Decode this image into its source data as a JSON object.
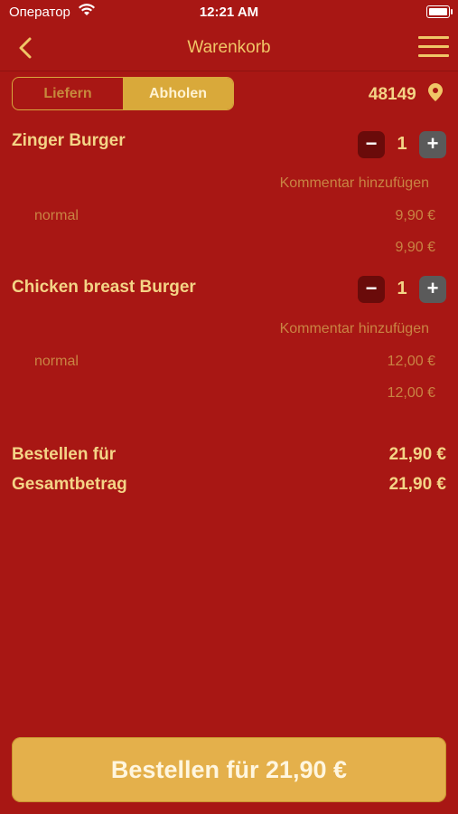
{
  "status_bar": {
    "carrier": "Оператор",
    "time": "12:21 AM"
  },
  "header": {
    "title": "Warenkorb"
  },
  "mode": {
    "options": [
      "Liefern",
      "Abholen"
    ],
    "selected": "Abholen"
  },
  "postal_code": "48149",
  "cart": {
    "items": [
      {
        "name": "Zinger Burger",
        "quantity": "1",
        "comment_placeholder": "Kommentar hinzufügen",
        "variant": "normal",
        "variant_price": "9,90 €",
        "total": "9,90 €"
      },
      {
        "name": "Chicken breast Burger",
        "quantity": "1",
        "comment_placeholder": "Kommentar hinzufügen",
        "variant": "normal",
        "variant_price": "12,00 €",
        "total": "12,00 €"
      }
    ],
    "qty_minus": "−",
    "qty_plus": "+"
  },
  "summary": {
    "order_for_label": "Bestellen für",
    "order_for_value": "21,90 €",
    "total_label": "Gesamtbetrag",
    "total_value": "21,90 €"
  },
  "order_button": "Bestellen für 21,90 €",
  "colors": {
    "background": "#a81714",
    "accent": "#e4b04b",
    "text": "#f0c667"
  }
}
